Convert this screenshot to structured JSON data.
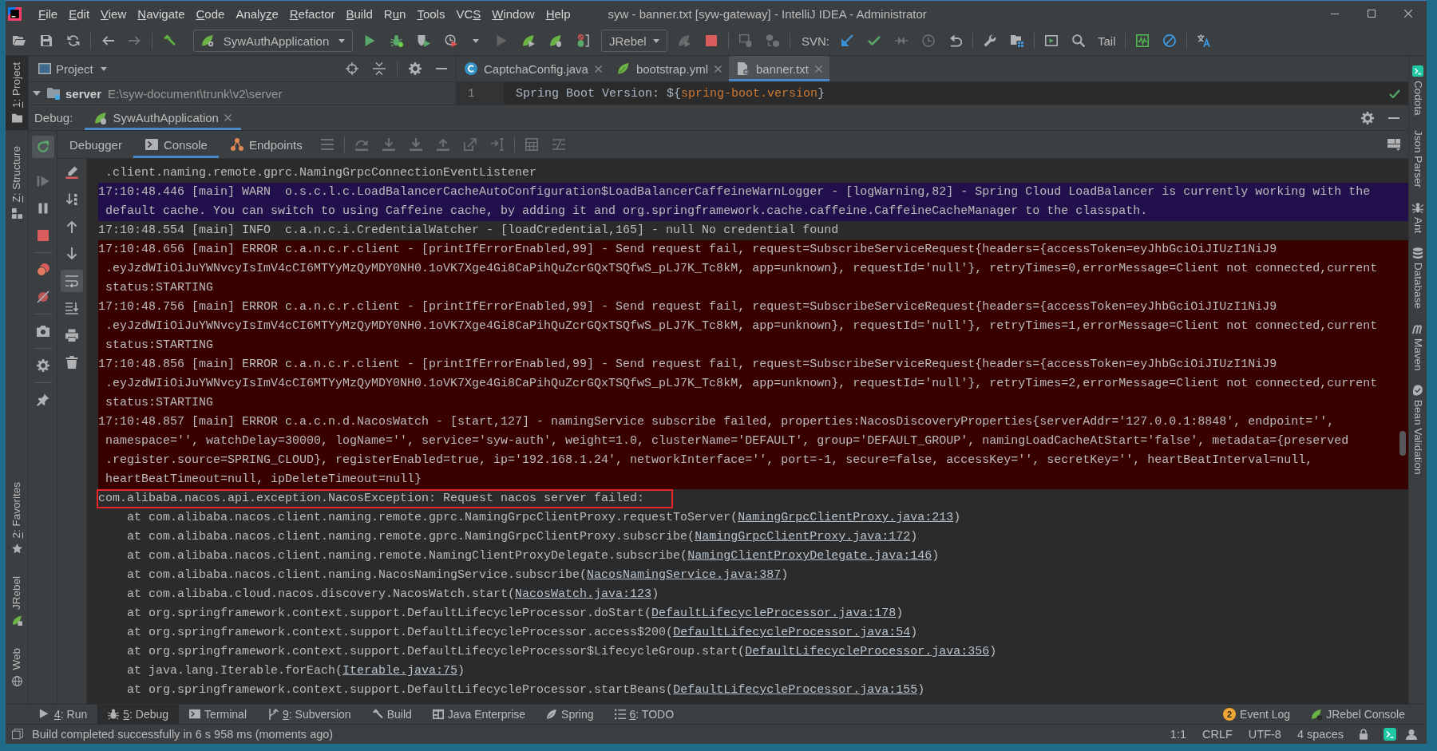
{
  "window": {
    "title": "syw - banner.txt [syw-gateway] - IntelliJ IDEA - Administrator"
  },
  "menu": [
    {
      "key": "F",
      "post": "ile"
    },
    {
      "key": "E",
      "post": "dit"
    },
    {
      "key": "V",
      "post": "iew"
    },
    {
      "key": "N",
      "post": "avigate"
    },
    {
      "key": "C",
      "post": "ode"
    },
    {
      "pre": "Analy",
      "key": "z",
      "post": "e"
    },
    {
      "key": "R",
      "post": "efactor"
    },
    {
      "key": "B",
      "post": "uild"
    },
    {
      "pre": "R",
      "key": "u",
      "post": "n"
    },
    {
      "key": "T",
      "post": "ools"
    },
    {
      "pre": "VC",
      "key": "S"
    },
    {
      "key": "W",
      "post": "indow"
    },
    {
      "key": "H",
      "post": "elp"
    }
  ],
  "toolbar": [
    {
      "kind": "open",
      "disabled": false
    },
    {
      "kind": "save",
      "disabled": false
    },
    {
      "kind": "sync",
      "disabled": false
    },
    {
      "kind": "separator"
    },
    {
      "kind": "back",
      "disabled": false
    },
    {
      "kind": "forward",
      "disabled": true
    },
    {
      "kind": "separator"
    },
    {
      "kind": "build",
      "disabled": false
    },
    {
      "kind": "config",
      "label": "SywAuthApplication"
    },
    {
      "kind": "run",
      "disabled": false
    },
    {
      "kind": "debug",
      "disabled": false
    },
    {
      "kind": "coverage",
      "disabled": false
    },
    {
      "kind": "profile",
      "disabled": false
    },
    {
      "kind": "run",
      "disabled": true
    },
    {
      "kind": "rebelrun",
      "disabled": false
    },
    {
      "kind": "rebeldebug",
      "disabled": false
    },
    {
      "kind": "rebelagent",
      "disabled": false
    },
    {
      "kind": "dropdown",
      "label": "JRebel"
    },
    {
      "kind": "rebelrun",
      "disabled": true
    },
    {
      "kind": "stop",
      "disabled": false
    },
    {
      "kind": "separator"
    },
    {
      "kind": "attach",
      "disabled": true
    },
    {
      "kind": "modules",
      "disabled": true
    },
    {
      "kind": "separator"
    },
    {
      "kind": "label",
      "label": "SVN:"
    },
    {
      "kind": "update",
      "disabled": false
    },
    {
      "kind": "commit",
      "disabled": false
    },
    {
      "kind": "compare",
      "disabled": true
    },
    {
      "kind": "history",
      "disabled": true
    },
    {
      "kind": "revert",
      "disabled": false
    },
    {
      "kind": "separator"
    },
    {
      "kind": "wrench",
      "disabled": false
    },
    {
      "kind": "structure",
      "disabled": false
    },
    {
      "kind": "separator"
    },
    {
      "kind": "terminal",
      "disabled": false
    },
    {
      "kind": "search",
      "disabled": false
    },
    {
      "kind": "textbutton",
      "label": "Tail"
    },
    {
      "kind": "separator"
    },
    {
      "kind": "monitor",
      "disabled": false
    },
    {
      "kind": "block",
      "disabled": false
    },
    {
      "kind": "separator"
    },
    {
      "kind": "translate",
      "disabled": false
    }
  ],
  "left_stripe": {
    "top": [
      {
        "key": "1",
        "label": ": Project",
        "kind": "project",
        "selected": true
      },
      {
        "key": "Z",
        "label": ": Structure",
        "kind": "structure",
        "selected": false
      }
    ],
    "bottom": [
      {
        "key": "2",
        "label": ": Favorites",
        "kind": "favorites",
        "selected": false
      },
      {
        "label": "JRebel",
        "kind": "jrebel",
        "selected": false
      },
      {
        "label": "Web",
        "kind": "web",
        "selected": false
      }
    ]
  },
  "right_stripe": [
    {
      "label": "Codota",
      "kind": "codota",
      "selected": false
    },
    {
      "label": "Json Parser",
      "kind": "plain",
      "selected": false
    },
    {
      "label": "Ant",
      "kind": "ant",
      "selected": false
    },
    {
      "label": "Database",
      "kind": "database",
      "selected": false
    },
    {
      "label": "Maven",
      "kind": "maven",
      "selected": false
    },
    {
      "label": "Bean Validation",
      "kind": "bean",
      "selected": false
    }
  ],
  "project_panel": {
    "title": "Project",
    "tree": [
      {
        "name": "server",
        "path": "E:\\syw-document\\trunk\\v2\\server",
        "expanded": true
      }
    ]
  },
  "editor": {
    "tabs": [
      {
        "label": "CaptchaConfig.java",
        "kind": "java",
        "selected": false
      },
      {
        "label": "bootstrap.yml",
        "kind": "yaml",
        "selected": false
      },
      {
        "label": "banner.txt",
        "kind": "text",
        "selected": true
      }
    ],
    "lines": [
      {
        "number": "1",
        "segments": [
          {
            "text": "Spring Boot Version: ${",
            "kind": "plain"
          },
          {
            "text": "spring-boot.version",
            "kind": "property"
          },
          {
            "text": "}",
            "kind": "plain"
          }
        ]
      }
    ]
  },
  "debug": {
    "label": "Debug:",
    "sessions": [
      {
        "label": "SywAuthApplication",
        "selected": true
      }
    ],
    "session_actions": [
      {
        "kind": "rerun",
        "on": true,
        "disabled": false
      },
      {
        "kind": "resume",
        "on": false,
        "disabled": true
      },
      {
        "kind": "pause",
        "on": false,
        "disabled": false
      },
      {
        "kind": "stop",
        "on": false,
        "disabled": false
      },
      {
        "kind": "separator"
      },
      {
        "kind": "breakpoints",
        "on": false,
        "disabled": false
      },
      {
        "kind": "mute",
        "on": false,
        "disabled": false
      },
      {
        "kind": "separator"
      },
      {
        "kind": "camera",
        "on": false,
        "disabled": false
      },
      {
        "kind": "separator"
      },
      {
        "kind": "settings",
        "on": false,
        "disabled": false
      },
      {
        "kind": "separator"
      },
      {
        "kind": "pin",
        "on": false,
        "disabled": false
      }
    ],
    "tabs": [
      {
        "label": "Debugger",
        "kind": "debugger",
        "selected": false
      },
      {
        "label": "Console",
        "kind": "console",
        "selected": true
      },
      {
        "label": "Endpoints",
        "kind": "endpoints",
        "selected": false
      }
    ],
    "console_actions": [
      {
        "kind": "pencil",
        "on": false
      },
      {
        "kind": "sort",
        "on": false
      },
      {
        "kind": "up",
        "on": false
      },
      {
        "kind": "down",
        "on": false
      },
      {
        "kind": "wrap",
        "on": true
      },
      {
        "kind": "scrollend",
        "on": false
      },
      {
        "kind": "print",
        "on": false
      },
      {
        "kind": "trash",
        "on": false
      }
    ],
    "console": [
      {
        "kind": "info",
        "wraps": [
          ".client.naming.remote.gprc.NamingGrpcConnectionEventListener"
        ]
      },
      {
        "kind": "warn",
        "head": "17:10:48.446 [main] WARN  o.s.c.l.c.LoadBalancerCacheAutoConfiguration$LoadBalancerCaffeineWarnLogger - [logWarning,82] - Spring Cloud LoadBalancer is currently working with the",
        "wraps": [
          "default cache. You can switch to using Caffeine cache, by adding it and org.springframework.cache.caffeine.CaffeineCacheManager to the classpath."
        ]
      },
      {
        "kind": "info",
        "head": "17:10:48.554 [main] INFO  c.a.n.c.i.CredentialWatcher - [loadCredential,165] - null No credential found"
      },
      {
        "kind": "error",
        "head": "17:10:48.656 [main] ERROR c.a.n.c.r.client - [printIfErrorEnabled,99] - Send request fail, request=SubscribeServiceRequest{headers={accessToken=eyJhbGciOiJIUzI1NiJ9",
        "wraps": [
          ".eyJzdWIiOiJuYWNvcyIsImV4cCI6MTYyMzQyMDY0NH0.1oVK7Xge4Gi8CaPihQuZcrGQxTSQfwS_pLJ7K_Tc8kM, app=unknown}, requestId='null'}, retryTimes=0,errorMessage=Client not connected,current",
          "status:STARTING"
        ]
      },
      {
        "kind": "error",
        "head": "17:10:48.756 [main] ERROR c.a.n.c.r.client - [printIfErrorEnabled,99] - Send request fail, request=SubscribeServiceRequest{headers={accessToken=eyJhbGciOiJIUzI1NiJ9",
        "wraps": [
          ".eyJzdWIiOiJuYWNvcyIsImV4cCI6MTYyMzQyMDY0NH0.1oVK7Xge4Gi8CaPihQuZcrGQxTSQfwS_pLJ7K_Tc8kM, app=unknown}, requestId='null'}, retryTimes=1,errorMessage=Client not connected,current",
          "status:STARTING"
        ]
      },
      {
        "kind": "error",
        "head": "17:10:48.856 [main] ERROR c.a.n.c.r.client - [printIfErrorEnabled,99] - Send request fail, request=SubscribeServiceRequest{headers={accessToken=eyJhbGciOiJIUzI1NiJ9",
        "wraps": [
          ".eyJzdWIiOiJuYWNvcyIsImV4cCI6MTYyMzQyMDY0NH0.1oVK7Xge4Gi8CaPihQuZcrGQxTSQfwS_pLJ7K_Tc8kM, app=unknown}, requestId='null'}, retryTimes=2,errorMessage=Client not connected,current",
          "status:STARTING"
        ]
      },
      {
        "kind": "error",
        "head": "17:10:48.857 [main] ERROR c.a.c.n.d.NacosWatch - [start,127] - namingService subscribe failed, properties:NacosDiscoveryProperties{serverAddr='127.0.0.1:8848', endpoint='',",
        "wraps": [
          "namespace='', watchDelay=30000, logName='', service='syw-auth', weight=1.0, clusterName='DEFAULT', group='DEFAULT_GROUP', namingLoadCacheAtStart='false', metadata={preserved",
          ".register.source=SPRING_CLOUD}, registerEnabled=true, ip='192.168.1.24', networkInterface='', port=-1, secure=false, accessKey='', secretKey='', heartBeatInterval=null,",
          "heartBeatTimeout=null, ipDeleteTimeout=null}"
        ]
      },
      {
        "kind": "exception",
        "boxed": true,
        "head": "com.alibaba.nacos.api.exception.NacosException: Request nacos server failed:",
        "frames": [
          {
            "text": "at com.alibaba.nacos.client.naming.remote.gprc.NamingGrpcClientProxy.requestToServer(",
            "link": "NamingGrpcClientProxy.java:213",
            "end": ")"
          },
          {
            "text": "at com.alibaba.nacos.client.naming.remote.gprc.NamingGrpcClientProxy.subscribe(",
            "link": "NamingGrpcClientProxy.java:172",
            "end": ")"
          },
          {
            "text": "at com.alibaba.nacos.client.naming.remote.NamingClientProxyDelegate.subscribe(",
            "link": "NamingClientProxyDelegate.java:146",
            "end": ")"
          },
          {
            "text": "at com.alibaba.nacos.client.naming.NacosNamingService.subscribe(",
            "link": "NacosNamingService.java:387",
            "end": ")"
          },
          {
            "text": "at com.alibaba.cloud.nacos.discovery.NacosWatch.start(",
            "link": "NacosWatch.java:123",
            "end": ")"
          },
          {
            "text": "at org.springframework.context.support.DefaultLifecycleProcessor.doStart(",
            "link": "DefaultLifecycleProcessor.java:178",
            "end": ")"
          },
          {
            "text": "at org.springframework.context.support.DefaultLifecycleProcessor.access$200(",
            "link": "DefaultLifecycleProcessor.java:54",
            "end": ")"
          },
          {
            "text": "at org.springframework.context.support.DefaultLifecycleProcessor$LifecycleGroup.start(",
            "link": "DefaultLifecycleProcessor.java:356",
            "end": ")"
          },
          {
            "text": "at java.lang.Iterable.forEach(",
            "link": "Iterable.java:75",
            "end": ")"
          },
          {
            "text": "at org.springframework.context.support.DefaultLifecycleProcessor.startBeans(",
            "link": "DefaultLifecycleProcessor.java:155",
            "end": ")"
          }
        ]
      }
    ]
  },
  "tool_windows": {
    "left": [
      {
        "key": "4",
        "label": ": Run",
        "kind": "run",
        "selected": false
      },
      {
        "key": "5",
        "label": ": Debug",
        "kind": "debug",
        "selected": true
      },
      {
        "label": "Terminal",
        "kind": "terminal",
        "selected": false
      },
      {
        "key": "9",
        "label": ": Subversion",
        "kind": "vcs",
        "selected": false
      },
      {
        "label": "Build",
        "kind": "build",
        "selected": false
      },
      {
        "label": "Java Enterprise",
        "kind": "javaee",
        "selected": false
      },
      {
        "label": "Spring",
        "kind": "spring",
        "selected": false
      },
      {
        "key": "6",
        "label": ": TODO",
        "kind": "todo",
        "selected": false
      }
    ],
    "right": [
      {
        "label": "Event Log",
        "kind": "eventlog",
        "badge": "2",
        "selected": false
      },
      {
        "label": "JRebel Console",
        "kind": "jrebel",
        "selected": false
      }
    ]
  },
  "status_bar": {
    "message": "Build completed successfully in 6 s 958 ms (moments ago)",
    "items": [
      "1:1",
      "CRLF",
      "UTF-8",
      "4 spaces"
    ]
  }
}
